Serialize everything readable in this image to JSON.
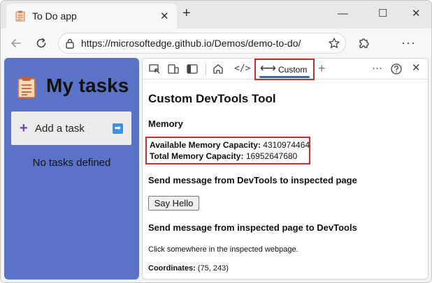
{
  "browser": {
    "tab_title": "To Do app",
    "url": "https://microsoftedge.github.io/Demos/demo-to-do/",
    "icons": [
      "tab-favicon-icon",
      "close-icon",
      "plus-icon",
      "minimize-icon",
      "maximize-icon",
      "close-window-icon",
      "back-icon",
      "refresh-icon",
      "lock-icon",
      "star-icon",
      "extensions-icon",
      "more-icon"
    ]
  },
  "todo_app": {
    "title": "My tasks",
    "add_task_label": "Add a task",
    "empty_message": "No tasks defined",
    "colors": {
      "background": "#5b73c6",
      "plus": "#6b46a3",
      "arrow": "#3b90e8"
    }
  },
  "devtools": {
    "active_tab_label": "Custom",
    "tool_title": "Custom DevTools Tool",
    "memory_heading": "Memory",
    "available_label": "Available Memory Capacity:",
    "available_value": "4310974464",
    "total_label": "Total Memory Capacity:",
    "total_value": "16952647680",
    "send_to_page_heading": "Send message from DevTools to inspected page",
    "say_hello_label": "Say Hello",
    "send_to_devtools_heading": "Send message from inspected page to DevTools",
    "click_instruction": "Click somewhere in the inspected webpage.",
    "coordinates_label": "Coordinates:",
    "coordinates_value": "(75, 243)",
    "highlight_color": "#d4282f",
    "active_underline_color": "#1d6ed9"
  }
}
